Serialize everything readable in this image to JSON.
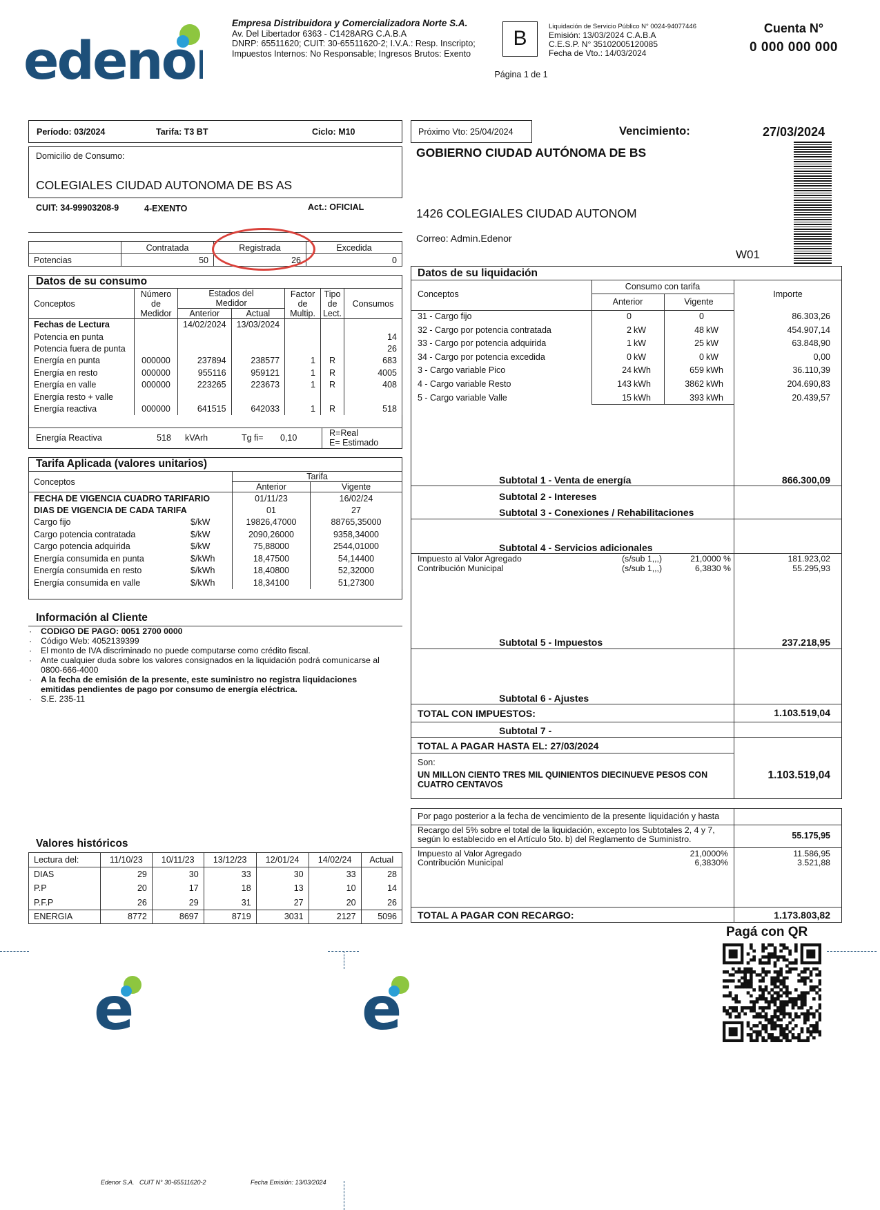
{
  "brand": {
    "logo_text": "edenor",
    "accent_green": "#8dc63f",
    "accent_blue": "#2a9fd6",
    "brand_navy": "#1d4f79"
  },
  "header": {
    "company": "Empresa Distribuidora y Comercializadora Norte S.A.",
    "address": "Av. Del Libertador 6363 - C1428ARG C.A.B.A",
    "dnrp": "DNRP: 65511620; CUIT: 30-65511620-2; I.V.A.: Resp. Inscripto;",
    "impuestos": "Impuestos Internos: No Responsable; Ingresos Brutos: Exento",
    "invoice_letter": "B",
    "liquidacion": "Liquidación de Servicio Público N° 0024-94077446",
    "emision": "Emisión: 13/03/2024 C.A.B.A",
    "cesp": "C.E.S.P. N° 35102005120085",
    "fecha_vto": "Fecha de Vto.: 14/03/2024",
    "pagina": "Página 1 de 1",
    "cuenta_label": "Cuenta N°",
    "cuenta_value": "0 000 000 000"
  },
  "period": {
    "periodo": "Período: 03/2024",
    "tarifa": "Tarifa: T3 BT",
    "ciclo": "Ciclo: M10"
  },
  "domicilio": {
    "label": "Domicilio de Consumo:",
    "value": "COLEGIALES CIUDAD AUTONOMA DE BS AS"
  },
  "cuit_line": {
    "cuit": "CUIT: 34-99903208-9",
    "iva": "4-EXENTO",
    "act": "Act.: OFICIAL"
  },
  "potencias": {
    "headers": [
      "Contratada",
      "Registrada",
      "Excedida"
    ],
    "label": "Potencias",
    "values": [
      "50",
      "26",
      "0"
    ]
  },
  "consumo": {
    "title": "Datos de su consumo",
    "h_conceptos": "Conceptos",
    "h_numero": [
      "Número",
      "de",
      "Medidor"
    ],
    "h_estados": [
      "Estados del",
      "Medidor"
    ],
    "h_anterior": "Anterior",
    "h_actual": "Actual",
    "h_factor": [
      "Factor",
      "de",
      "Multip."
    ],
    "h_tipo": [
      "Tipo",
      "de",
      "Lect."
    ],
    "h_consumos": "Consumos",
    "rows": [
      {
        "c": "Fechas de Lectura",
        "n": "",
        "a": "14/02/2024",
        "ac": "13/03/2024",
        "f": "",
        "t": "",
        "v": ""
      },
      {
        "c": "Potencia en punta",
        "n": "",
        "a": "",
        "ac": "",
        "f": "",
        "t": "",
        "v": "14"
      },
      {
        "c": "Potencia fuera de punta",
        "n": "",
        "a": "",
        "ac": "",
        "f": "",
        "t": "",
        "v": "26"
      },
      {
        "c": "Energía en punta",
        "n": "000000",
        "a": "237894",
        "ac": "238577",
        "f": "1",
        "t": "R",
        "v": "683"
      },
      {
        "c": "Energía en resto",
        "n": "000000",
        "a": "955116",
        "ac": "959121",
        "f": "1",
        "t": "R",
        "v": "4005"
      },
      {
        "c": "Energía en valle",
        "n": "000000",
        "a": "223265",
        "ac": "223673",
        "f": "1",
        "t": "R",
        "v": "408"
      },
      {
        "c": "Energía resto + valle",
        "n": "",
        "a": "",
        "ac": "",
        "f": "",
        "t": "",
        "v": ""
      },
      {
        "c": "Energía reactiva",
        "n": "000000",
        "a": "641515",
        "ac": "642033",
        "f": "1",
        "t": "R",
        "v": "518"
      }
    ],
    "reactiva_label": "Energía Reactiva",
    "reactiva_value": "518",
    "reactiva_unit": "kVArh",
    "tgfi_label": "Tg fi=",
    "tgfi_value": "0,10",
    "legend_real": "R=Real",
    "legend_estimado": "E= Estimado"
  },
  "tarifa": {
    "title": "Tarifa Aplicada (valores unitarios)",
    "h_conceptos": "Conceptos",
    "h_tarifa": "Tarifa",
    "h_anterior": "Anterior",
    "h_vigente": "Vigente",
    "rows_bold": [
      {
        "c": "FECHA DE VIGENCIA CUADRO TARIFARIO",
        "a": "01/11/23",
        "v": "16/02/24"
      },
      {
        "c": "DIAS DE VIGENCIA DE CADA TARIFA",
        "a": "01",
        "v": "27"
      }
    ],
    "rows": [
      {
        "c": "Cargo fijo",
        "u": "$/kW",
        "a": "19826,47000",
        "v": "88765,35000"
      },
      {
        "c": "Cargo potencia contratada",
        "u": "$/kW",
        "a": "2090,26000",
        "v": "9358,34000"
      },
      {
        "c": "Cargo potencia adquirida",
        "u": "$/kW",
        "a": "75,88000",
        "v": "2544,01000"
      },
      {
        "c": "Energía consumida en punta",
        "u": "$/kWh",
        "a": "18,47500",
        "v": "54,14400"
      },
      {
        "c": "Energía consumida en resto",
        "u": "$/kWh",
        "a": "18,40800",
        "v": "52,32000"
      },
      {
        "c": "Energía consumida en valle",
        "u": "$/kWh",
        "a": "18,34100",
        "v": "51,27300"
      }
    ]
  },
  "info": {
    "title": "Información al Cliente",
    "items": [
      {
        "text": "CODIGO DE PAGO: 0051 2700 0000",
        "bold": true
      },
      {
        "text": "Código Web: 4052139399",
        "bold": false
      },
      {
        "text": "El monto de IVA discriminado no puede computarse como crédito fiscal.",
        "bold": false
      },
      {
        "text": "Ante cualquier duda sobre los valores consignados en la liquidación podrá comunicarse al 0800-666-4000",
        "bold": false
      },
      {
        "text": "A la fecha de emisión de la presente, este suministro no registra liquidaciones emitidas pendientes de pago por consumo de energía eléctrica.",
        "bold": true
      },
      {
        "text": "S.E. 235-11",
        "bold": false
      }
    ]
  },
  "historicos": {
    "title": "Valores históricos",
    "headers": [
      "Lectura del:",
      "11/10/23",
      "10/11/23",
      "13/12/23",
      "12/01/24",
      "14/02/24",
      "Actual"
    ],
    "rows": [
      [
        "DIAS",
        "29",
        "30",
        "33",
        "30",
        "33",
        "28"
      ],
      [
        "P.P",
        "20",
        "17",
        "18",
        "13",
        "10",
        "14"
      ],
      [
        "P.F.P",
        "26",
        "29",
        "31",
        "27",
        "20",
        "26"
      ],
      [
        "ENERGIA",
        "8772",
        "8697",
        "8719",
        "3031",
        "2127",
        "5096"
      ]
    ]
  },
  "right": {
    "proximo_vto": "Próximo Vto: 25/04/2024",
    "vencimiento_label": "Vencimiento:",
    "vencimiento_value": "27/03/2024",
    "cliente": "GOBIERNO CIUDAD AUTÓNOMA DE BS",
    "direccion": "1426 COLEGIALES CIUDAD AUTONOM",
    "correo": "Correo: Admin.Edenor",
    "zona": "W01"
  },
  "liquidacion": {
    "title": "Datos de su liquidación",
    "h_conceptos": "Conceptos",
    "h_consumo": "Consumo con tarifa",
    "h_anterior": "Anterior",
    "h_vigente": "Vigente",
    "h_importe": "Importe",
    "rows": [
      {
        "c": "31 - Cargo fijo",
        "a": "0",
        "au": "",
        "v": "0",
        "vu": "",
        "i": "86.303,26"
      },
      {
        "c": "32 - Cargo por potencia contratada",
        "a": "2",
        "au": "kW",
        "v": "48",
        "vu": "kW",
        "i": "454.907,14"
      },
      {
        "c": "33 - Cargo por potencia adquirida",
        "a": "1",
        "au": "kW",
        "v": "25",
        "vu": "kW",
        "i": "63.848,90"
      },
      {
        "c": "34 - Cargo por potencia excedida",
        "a": "0",
        "au": "kW",
        "v": "0",
        "vu": "kW",
        "i": "0,00"
      },
      {
        "c": "3 - Cargo variable Pico",
        "a": "24",
        "au": "kWh",
        "v": "659",
        "vu": "kWh",
        "i": "36.110,39"
      },
      {
        "c": "4 - Cargo variable Resto",
        "a": "143",
        "au": "kWh",
        "v": "3862",
        "vu": "kWh",
        "i": "204.690,83"
      },
      {
        "c": "5 - Cargo variable Valle",
        "a": "15",
        "au": "kWh",
        "v": "393",
        "vu": "kWh",
        "i": "20.439,57"
      }
    ],
    "subtotal1_label": "Subtotal 1 - Venta de energía",
    "subtotal1_value": "866.300,09",
    "subtotal2_label": "Subtotal 2 - Intereses",
    "subtotal3_label": "Subtotal 3 - Conexiones / Rehabilitaciones",
    "subtotal4_label": "Subtotal 4 - Servicios adicionales",
    "impuestos": [
      {
        "c": "Impuesto al Valor Agregado",
        "base": "(s/sub 1,,,)",
        "pct": "21,0000 %",
        "i": "181.923,02"
      },
      {
        "c": "Contribución Municipal",
        "base": "(s/sub 1,,,)",
        "pct": "6,3830 %",
        "i": "55.295,93"
      }
    ],
    "subtotal5_label": "Subtotal 5 - Impuestos",
    "subtotal5_value": "237.218,95",
    "subtotal6_label": "Subtotal 6 - Ajustes",
    "total_con_impuestos_label": "TOTAL CON IMPUESTOS:",
    "total_con_impuestos_value": "1.103.519,04",
    "subtotal7_label": "Subtotal 7 -",
    "total_pagar_label": "TOTAL A PAGAR HASTA EL: 27/03/2024",
    "son_label": "Son:",
    "son_text": "UN MILLON CIENTO TRES MIL QUINIENTOS DIECINUEVE PESOS CON CUATRO  CENTAVOS",
    "total_pagar_value": "1.103.519,04"
  },
  "recargo": {
    "header": "Por pago posterior a la fecha de vencimiento de la presente liquidación y hasta",
    "texto": "Recargo del 5% sobre el total de la liquidación, excepto los Subtotales 2, 4 y 7, según lo establecido en el Artículo 5to. b) del Reglamento de Suministro.",
    "texto_value": "55.175,95",
    "impuestos": [
      {
        "c": "Impuesto al Valor Agregado",
        "pct": "21,0000%",
        "i": "11.586,95"
      },
      {
        "c": "Contribución Municipal",
        "pct": "6,3830%",
        "i": "3.521,88"
      }
    ],
    "total_label": "TOTAL A PAGAR CON RECARGO:",
    "total_value": "1.173.803,82"
  },
  "qr": {
    "label": "Pagá con QR"
  },
  "footer": {
    "company": "Edenor S.A.   CUIT N° 30-65511620-2",
    "fecha": "Fecha Emisión: 13/03/2024"
  }
}
